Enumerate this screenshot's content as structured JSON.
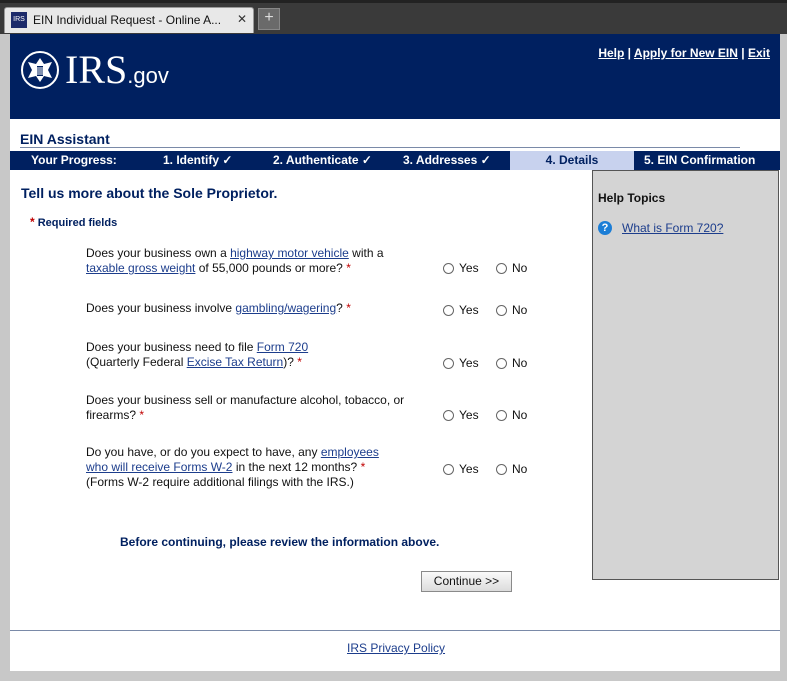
{
  "browser": {
    "tab_title": "EIN Individual Request - Online A...",
    "tab_close": "✕",
    "new_tab": "+"
  },
  "header": {
    "logo_main": "IRS",
    "logo_suffix": ".gov",
    "links": [
      "Help",
      "Apply for New EIN",
      "Exit"
    ],
    "separator": "|"
  },
  "assistant_title": "EIN Assistant",
  "progress": {
    "label": "Your Progress:",
    "steps": [
      {
        "label": "1. Identify",
        "check": "✓"
      },
      {
        "label": "2. Authenticate",
        "check": "✓"
      },
      {
        "label": "3. Addresses",
        "check": "✓"
      },
      {
        "label": "4. Details",
        "check": ""
      },
      {
        "label": "5. EIN Confirmation",
        "check": ""
      }
    ],
    "current_step": 4
  },
  "form": {
    "title": "Tell us more about the Sole Proprietor.",
    "required_star": "*",
    "required_label": "Required fields",
    "yes_label": "Yes",
    "no_label": "No",
    "q1": {
      "pre": "Does your business own a ",
      "link1": "highway motor vehicle",
      "mid": " with a",
      "link2": "taxable gross weight",
      "post": " of 55,000 pounds or more?",
      "star": "*"
    },
    "q2": {
      "pre": "Does your business involve ",
      "link1": "gambling/wagering",
      "post": "?",
      "star": "*"
    },
    "q3": {
      "pre": "Does your business need to file ",
      "link1": "Form 720",
      "line2_pre": "(Quarterly Federal ",
      "link2": "Excise Tax Return",
      "post": ")?",
      "star": "*"
    },
    "q4": {
      "text": "Does your business sell or manufacture alcohol, tobacco, or firearms?",
      "star": "*"
    },
    "q5": {
      "pre": "Do you have, or do you expect to have, any ",
      "link1": "employees",
      "link2": "who will receive Forms W-2",
      "post": " in the next 12 months?",
      "star": "*",
      "note": "(Forms W-2 require additional filings with the IRS.)"
    },
    "review_note": "Before continuing, please review the information above.",
    "continue_label": "Continue >>"
  },
  "help": {
    "title": "Help Topics",
    "icon": "?",
    "link": "What is Form 720?"
  },
  "footer": {
    "privacy_link": "IRS Privacy Policy"
  },
  "colors": {
    "navy": "#002060",
    "link": "#1c3d8c",
    "required_star": "#c00000",
    "current_step_bg": "#c8d2ee",
    "help_bg": "#d4d4d4"
  }
}
